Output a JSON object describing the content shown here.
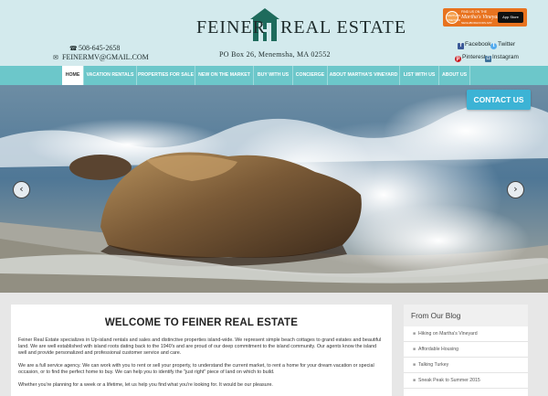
{
  "header": {
    "logo_left": "FEINER",
    "logo_right": "REAL ESTATE",
    "address": "PO Box 26, Menemsha, MA 02552",
    "phone": "508-645-2658",
    "email": "feinermv@gmail.com",
    "mv_badge": {
      "line1": "FIND US ON THE",
      "line2": "Martha's Vineyard",
      "line3": "NEIGHBORHOODS APP",
      "store": "App Store",
      "disc": "MARTHA'S VINEYARD"
    },
    "social": {
      "facebook": "Facebook",
      "twitter": "Twitter",
      "pinterest": "Pinterest",
      "instagram": "Instagram"
    }
  },
  "nav": {
    "items": [
      {
        "label": "HOME",
        "active": true
      },
      {
        "label": "VACATION RENTALS",
        "active": false
      },
      {
        "label": "PROPERTIES FOR SALE",
        "active": false
      },
      {
        "label": "NEW ON THE MARKET",
        "active": false
      },
      {
        "label": "BUY WITH US",
        "active": false
      },
      {
        "label": "CONCIERGE",
        "active": false
      },
      {
        "label": "ABOUT MARTHA'S VINEYARD",
        "active": false
      },
      {
        "label": "LIST WITH US",
        "active": false
      },
      {
        "label": "ABOUT US",
        "active": false
      }
    ]
  },
  "hero": {
    "contact_button": "CONTACT US",
    "prev_icon": "chevron-left-icon",
    "next_icon": "chevron-right-icon"
  },
  "welcome": {
    "title": "WELCOME TO FEINER REAL ESTATE",
    "paragraphs": [
      "Feiner Real Estate specializes in Up-island rentals and sales and distinctive properties island-wide. We represent simple beach cottages to grand estates and beautiful land. We are well established with island roots dating back to the 1940's and are proud of our deep commitment to the island community. Our agents know the island well and provide personalized and professional customer service and care.",
      "We are a full service agency. We can work with you to rent or sell your property, to understand the current market, to rent a home for your dream vacation or special occasion, or to find the perfect home to buy. We can help you to identify the \"just right\" piece of land on which to build.",
      "Whether you're planning for a week or a lifetime, let us help you find what you're looking for. It would be our pleasure."
    ]
  },
  "blog": {
    "title": "From Our Blog",
    "items": [
      "Hiking on Martha's Vineyard",
      "Affordable Housing",
      "Talking Turkey",
      "Sneak Peak to Summer 2015"
    ]
  },
  "colors": {
    "header_bg": "#d3eaed",
    "nav_bg": "#6cc7ca",
    "contact_button": "#3cb3d5",
    "badge_orange": "#e8731f"
  }
}
